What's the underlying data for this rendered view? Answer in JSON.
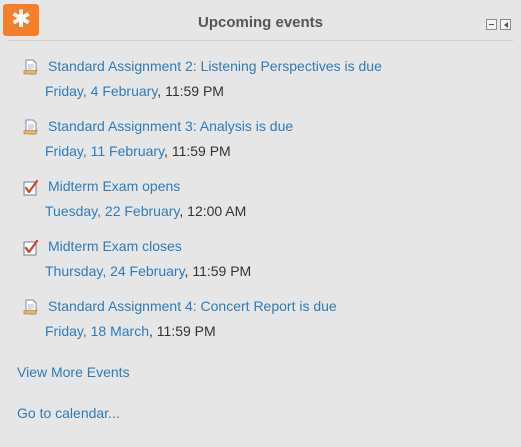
{
  "block": {
    "title": "Upcoming events",
    "icon": "asterisk-icon",
    "accent": "#f47e2a",
    "link_color": "#2f7ab8"
  },
  "events": [
    {
      "icon": "assignment-icon",
      "name": "Standard Assignment 2: Listening Perspectives is due",
      "day": "Friday, 4 February",
      "sep": ",",
      "time": "11:59 PM"
    },
    {
      "icon": "assignment-icon",
      "name": "Standard Assignment 3: Analysis is due",
      "day": "Friday, 11 February",
      "sep": ",",
      "time": "11:59 PM"
    },
    {
      "icon": "quiz-icon",
      "name": "Midterm Exam opens",
      "day": "Tuesday, 22 February",
      "sep": ",",
      "time": "12:00 AM"
    },
    {
      "icon": "quiz-icon",
      "name": "Midterm Exam closes",
      "day": "Thursday, 24 February",
      "sep": ",",
      "time": "11:59 PM"
    },
    {
      "icon": "assignment-icon",
      "name": "Standard Assignment 4: Concert Report is due",
      "day": "Friday, 18 March",
      "sep": ",",
      "time": "11:59 PM"
    }
  ],
  "footer": {
    "view_more": "View More Events",
    "calendar": "Go to calendar..."
  }
}
